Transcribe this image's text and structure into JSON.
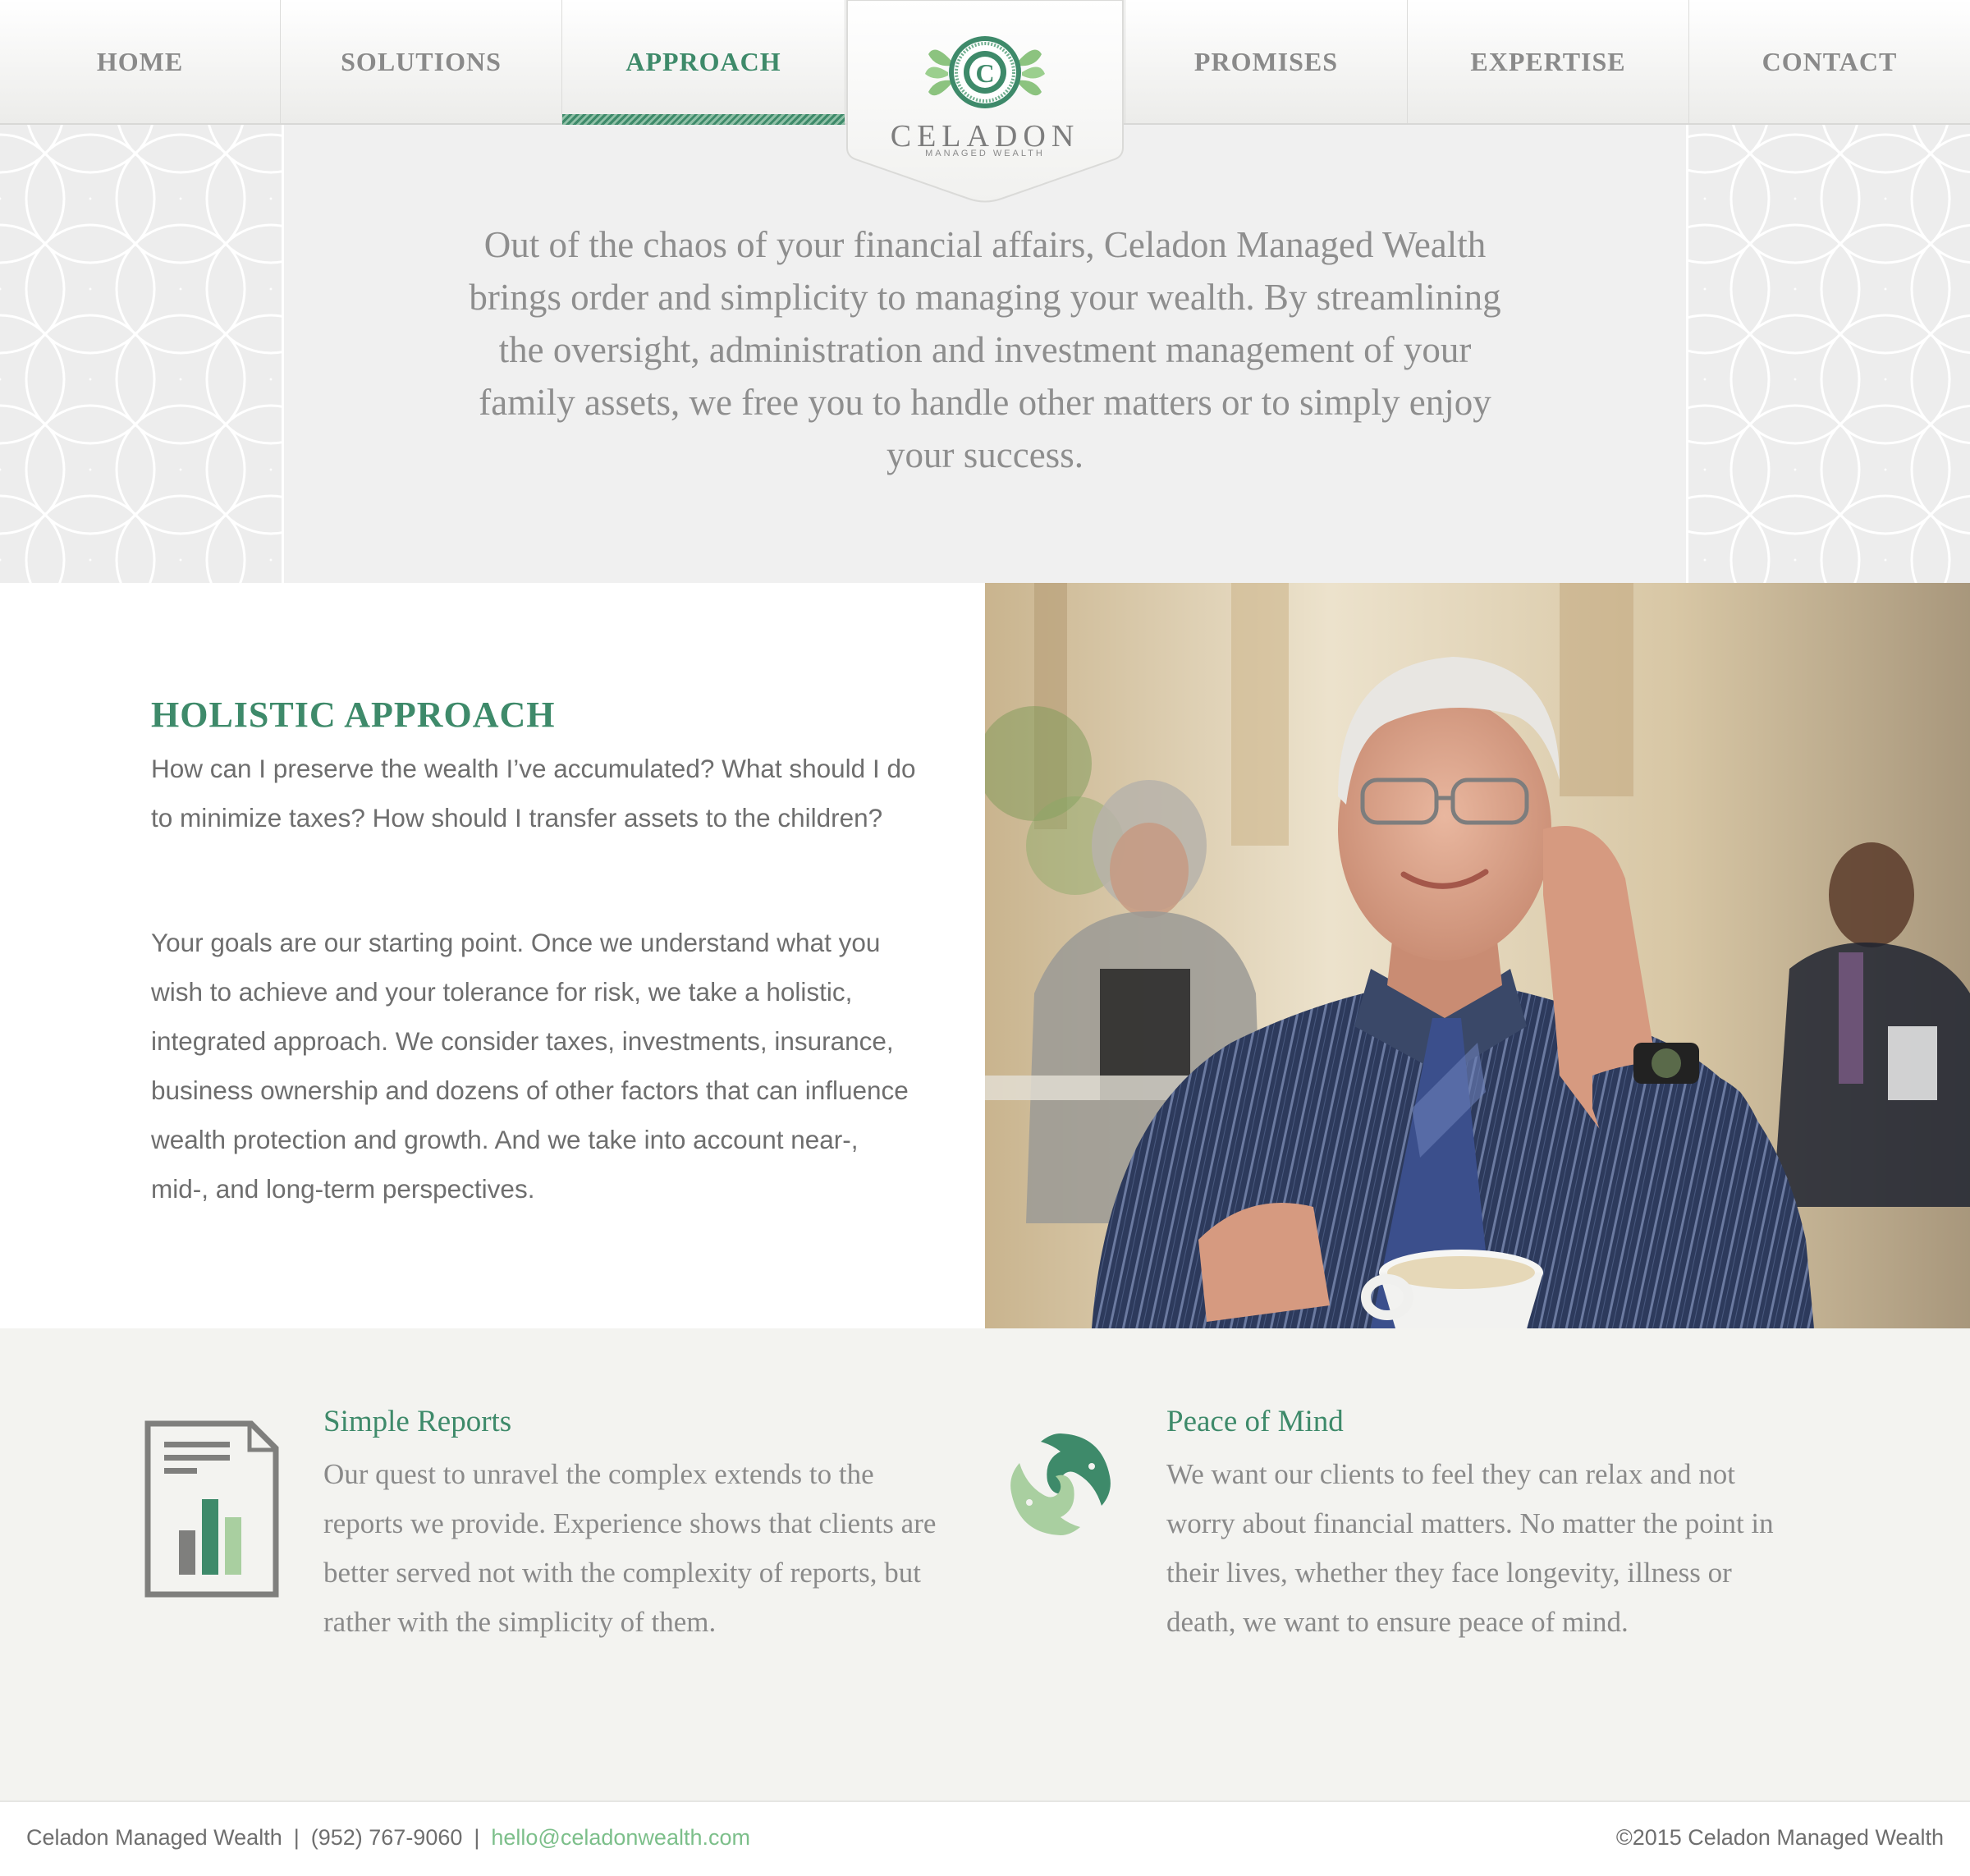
{
  "nav": {
    "left_items": [
      {
        "label": "HOME",
        "active": false
      },
      {
        "label": "SOLUTIONS",
        "active": false
      },
      {
        "label": "APPROACH",
        "active": true
      }
    ],
    "right_items": [
      {
        "label": "PROMISES",
        "active": false
      },
      {
        "label": "EXPERTISE",
        "active": false
      },
      {
        "label": "CONTACT",
        "active": false
      }
    ]
  },
  "logo": {
    "letter": "C",
    "name": "CELADON",
    "tagline": "MANAGED WEALTH",
    "icon": "leaf-medallion-logo"
  },
  "intro": {
    "text": "Out of the chaos of your financial affairs, Celadon Managed Wealth brings order and simplicity to managing your wealth. By streamlining the oversight, administration and investment management of your family assets, we free you to handle other matters or to simply enjoy your success."
  },
  "holistic": {
    "title": "HOLISTIC APPROACH",
    "paragraphs": [
      "How can I preserve the wealth I’ve accumulated? What should I do to minimize taxes? How should I transfer assets to the children?",
      "Your goals are our starting point. Once we understand what you wish to achieve and your tolerance for risk, we take a holistic, integrated approach. We consider taxes, investments, insurance, business ownership and dozens of other factors that can influence wealth protection and growth. And we take into account near-, mid-, and long-term perspectives."
    ],
    "photo": "smiling-man-cafe-photo"
  },
  "features": [
    {
      "title": "Simple Reports",
      "text": "Our quest to unravel the complex extends to the reports we provide. Experience shows that clients are better served not with the complexity of reports, but rather with the simplicity of them.",
      "icon": "report-chart-icon"
    },
    {
      "title": "Peace of Mind",
      "text": "We want our clients to feel they can relax and not worry about financial matters. No matter the point in their lives, whether they face longevity, illness or death, we want to ensure peace of mind.",
      "icon": "koi-fish-icon"
    }
  ],
  "footer": {
    "company": "Celadon Managed Wealth",
    "separator": "|",
    "phone": "(952) 767-9060",
    "email": "hello@celadonwealth.com",
    "copyright": "©2015 Celadon Managed Wealth"
  },
  "colors": {
    "accent": "#3e8a6a",
    "accent_light": "#8fc0a6",
    "email_link": "#7cbf8a",
    "nav_text": "#8a8a8a",
    "body_text": "#6e6e6e"
  }
}
